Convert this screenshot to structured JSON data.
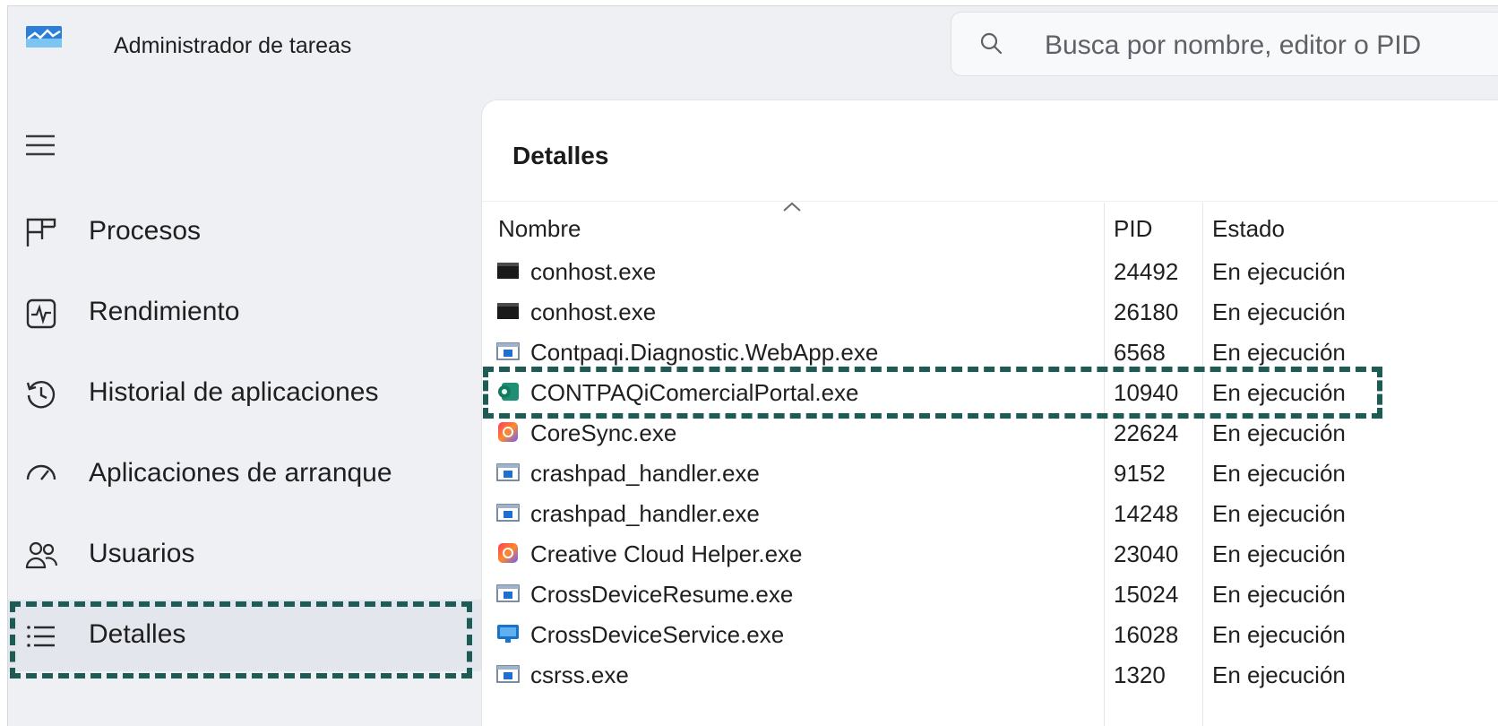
{
  "app": {
    "title": "Administrador de tareas",
    "icon": "task-manager-icon"
  },
  "search": {
    "placeholder": "Busca por nombre, editor o PID"
  },
  "sidebar": {
    "menu_icon": "hamburger-icon",
    "items": [
      {
        "label": "Procesos",
        "icon": "processes-grid-icon"
      },
      {
        "label": "Rendimiento",
        "icon": "performance-pulse-icon"
      },
      {
        "label": "Historial de aplicaciones",
        "icon": "history-clock-icon"
      },
      {
        "label": "Aplicaciones de arranque",
        "icon": "startup-speedometer-icon"
      },
      {
        "label": "Usuarios",
        "icon": "users-icon"
      },
      {
        "label": "Detalles",
        "icon": "details-list-icon",
        "active": true
      }
    ]
  },
  "main": {
    "title": "Detalles",
    "columns": {
      "name": "Nombre",
      "pid": "PID",
      "state": "Estado"
    },
    "rows": [
      {
        "name": "conhost.exe",
        "pid": "24492",
        "state": "En ejecución",
        "icon": "console-icon"
      },
      {
        "name": "conhost.exe",
        "pid": "26180",
        "state": "En ejecución",
        "icon": "console-icon"
      },
      {
        "name": "Contpaqi.Diagnostic.WebApp.exe",
        "pid": "6568",
        "state": "En ejecución",
        "icon": "app-window-icon"
      },
      {
        "name": "CONTPAQiComercialPortal.exe",
        "pid": "10940",
        "state": "En ejecución",
        "icon": "contpaqi-icon",
        "highlighted": true
      },
      {
        "name": "CoreSync.exe",
        "pid": "22624",
        "state": "En ejecución",
        "icon": "creative-cloud-icon"
      },
      {
        "name": "crashpad_handler.exe",
        "pid": "9152",
        "state": "En ejecución",
        "icon": "app-window-icon"
      },
      {
        "name": "crashpad_handler.exe",
        "pid": "14248",
        "state": "En ejecución",
        "icon": "app-window-icon"
      },
      {
        "name": "Creative Cloud Helper.exe",
        "pid": "23040",
        "state": "En ejecución",
        "icon": "creative-cloud-icon"
      },
      {
        "name": "CrossDeviceResume.exe",
        "pid": "15024",
        "state": "En ejecución",
        "icon": "app-window-icon"
      },
      {
        "name": "CrossDeviceService.exe",
        "pid": "16028",
        "state": "En ejecución",
        "icon": "cross-device-icon"
      },
      {
        "name": "csrss.exe",
        "pid": "1320",
        "state": "En ejecución",
        "icon": "app-window-icon"
      }
    ]
  },
  "colors": {
    "highlight_dash": "#1d5c54",
    "window_bg": "#eef0f4",
    "panel_bg": "#ffffff"
  }
}
